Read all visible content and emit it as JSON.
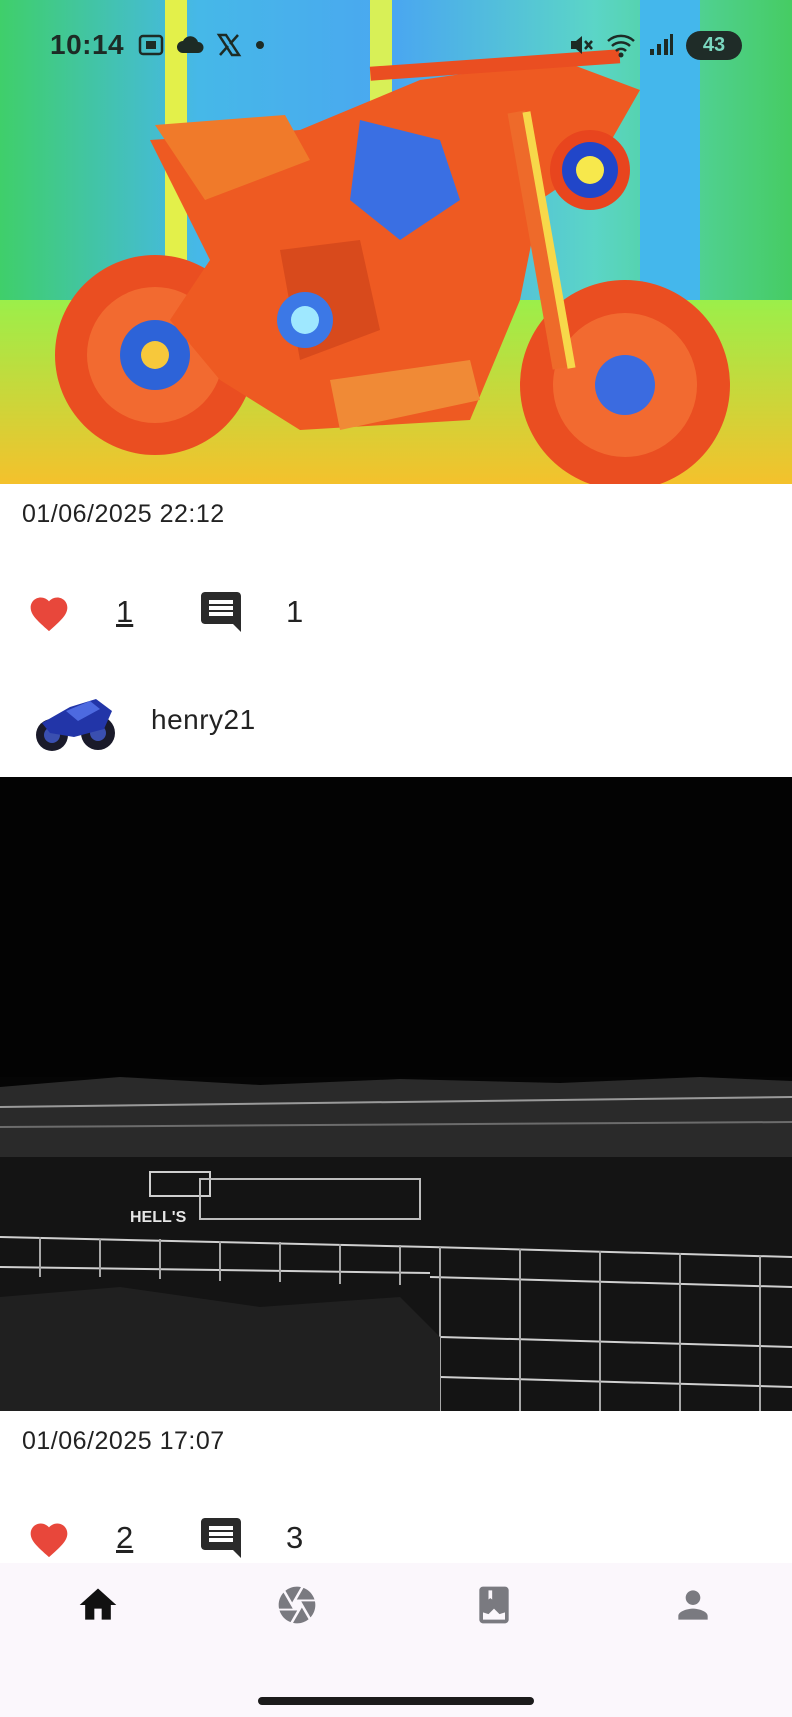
{
  "status_bar": {
    "time": "10:14",
    "battery": "43",
    "icons": [
      "screenshot-icon",
      "cloud-icon",
      "x-logo-icon",
      "dot-icon",
      "mute-icon",
      "wifi-icon",
      "signal-icon"
    ]
  },
  "posts": [
    {
      "image_desc": "thermal-motorcycle",
      "date": "01/06/2025 22:12",
      "likes": "1",
      "comments": "1",
      "author": "henry21"
    },
    {
      "image_desc": "edge-detected-landscape",
      "date": "01/06/2025 17:07",
      "likes": "2",
      "comments": "3"
    }
  ],
  "nav": {
    "items": [
      "home-icon",
      "camera-aperture-icon",
      "photo-bookmark-icon",
      "person-icon"
    ],
    "active": "home-icon"
  },
  "colors": {
    "like": "#e8473b",
    "nav_background": "#fbf7fc",
    "nav_inactive": "#7a7a80",
    "nav_active": "#111111"
  }
}
